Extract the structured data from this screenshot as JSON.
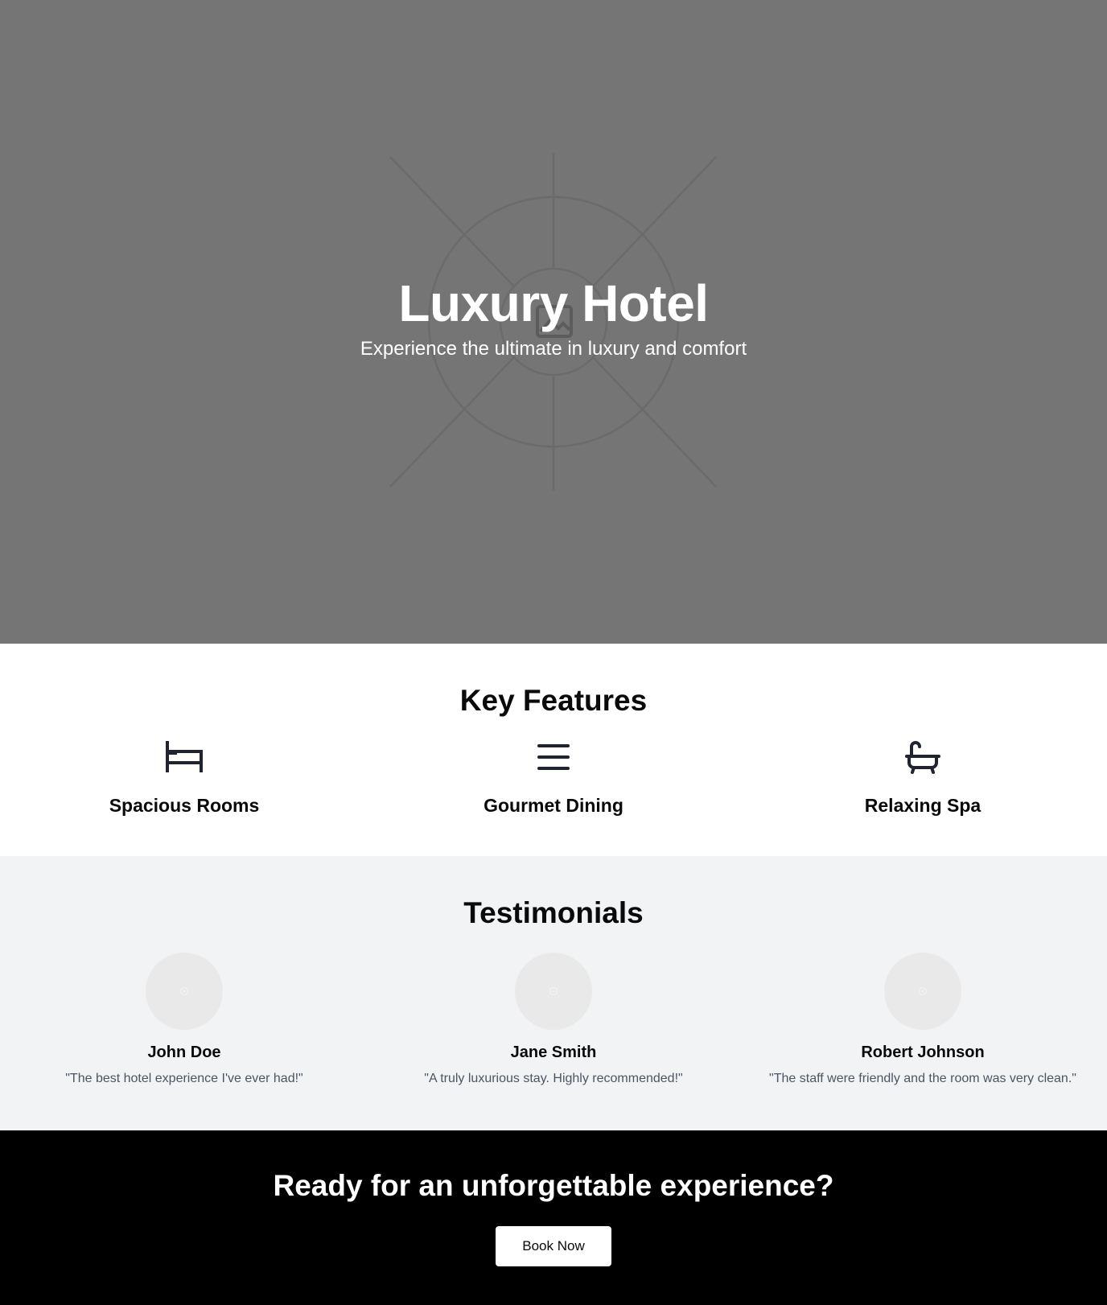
{
  "hero": {
    "title": "Luxury Hotel",
    "subtitle": "Experience the ultimate in luxury and comfort",
    "background_color": "#757575",
    "background_icon": "image-placeholder-icon"
  },
  "features": {
    "title": "Key Features",
    "items": [
      {
        "icon": "bed-icon",
        "label": "Spacious Rooms"
      },
      {
        "icon": "menu-lines-icon",
        "label": "Gourmet Dining"
      },
      {
        "icon": "bathtub-icon",
        "label": "Relaxing Spa"
      }
    ]
  },
  "testimonials": {
    "title": "Testimonials",
    "background_color": "#f2f3f4",
    "items": [
      {
        "avatar": "avatar-placeholder-icon",
        "name": "John Doe",
        "quote": "\"The best hotel experience I've ever had!\""
      },
      {
        "avatar": "avatar-placeholder-icon",
        "name": "Jane Smith",
        "quote": "\"A truly luxurious stay. Highly recommended!\""
      },
      {
        "avatar": "avatar-placeholder-icon",
        "name": "Robert Johnson",
        "quote": "\"The staff were friendly and the room was very clean.\""
      }
    ]
  },
  "cta": {
    "title": "Ready for an unforgettable experience?",
    "button_label": "Book Now",
    "background_color": "#000000"
  }
}
